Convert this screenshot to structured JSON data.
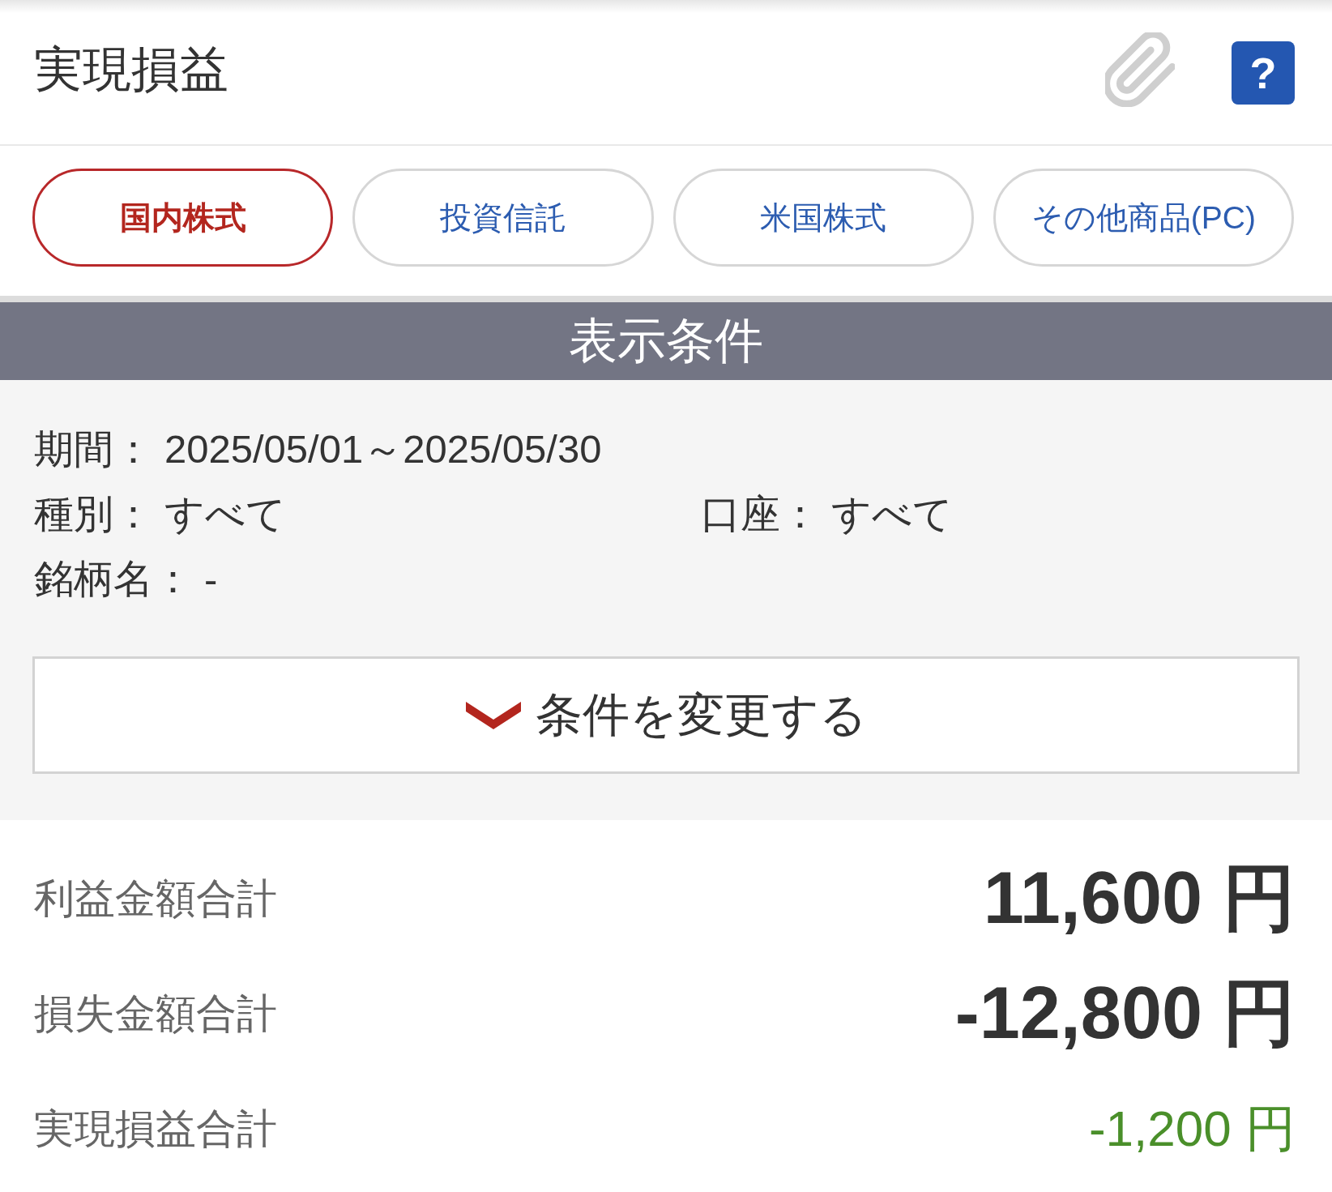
{
  "header": {
    "title": "実現損益",
    "help_label": "?"
  },
  "tabs": [
    {
      "label": "国内株式",
      "selected": true
    },
    {
      "label": "投資信託",
      "selected": false
    },
    {
      "label": "米国株式",
      "selected": false
    },
    {
      "label": "その他商品(PC)",
      "selected": false
    }
  ],
  "conditions": {
    "title": "表示条件",
    "rows": [
      {
        "items": [
          {
            "label": "期間：",
            "value": "2025/05/01～2025/05/30"
          }
        ]
      },
      {
        "items": [
          {
            "label": "種別：",
            "value": "すべて"
          },
          {
            "label": "口座：",
            "value": "すべて"
          }
        ]
      },
      {
        "items": [
          {
            "label": "銘柄名：",
            "value": "-"
          }
        ]
      }
    ],
    "change_button": "条件を変更する"
  },
  "totals": [
    {
      "label": "利益金額合計",
      "value": "11,600 円",
      "kind": "gross"
    },
    {
      "label": "損失金額合計",
      "value": "-12,800 円",
      "kind": "gross"
    },
    {
      "label": "実現損益合計",
      "value": "-1,200 円",
      "kind": "net"
    }
  ]
}
